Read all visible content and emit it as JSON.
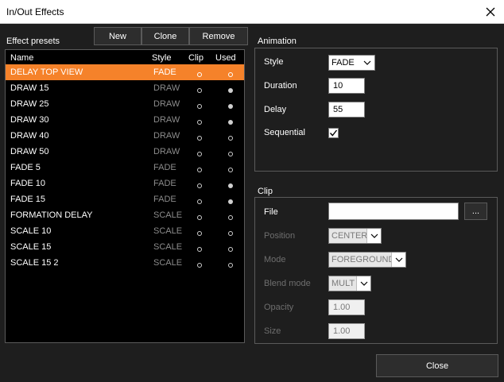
{
  "window": {
    "title": "In/Out Effects"
  },
  "presets": {
    "title": "Effect presets",
    "buttons": {
      "new": "New",
      "clone": "Clone",
      "remove": "Remove"
    },
    "columns": {
      "name": "Name",
      "style": "Style",
      "clip": "Clip",
      "used": "Used"
    },
    "rows": [
      {
        "name": "DELAY TOP VIEW",
        "style": "FADE",
        "clip": false,
        "used": false,
        "selected": true
      },
      {
        "name": "DRAW 15",
        "style": "DRAW",
        "clip": false,
        "used": true
      },
      {
        "name": "DRAW 25",
        "style": "DRAW",
        "clip": false,
        "used": true
      },
      {
        "name": "DRAW 30",
        "style": "DRAW",
        "clip": false,
        "used": true
      },
      {
        "name": "DRAW 40",
        "style": "DRAW",
        "clip": false,
        "used": false
      },
      {
        "name": "DRAW 50",
        "style": "DRAW",
        "clip": false,
        "used": false
      },
      {
        "name": "FADE 5",
        "style": "FADE",
        "clip": false,
        "used": false
      },
      {
        "name": "FADE 10",
        "style": "FADE",
        "clip": false,
        "used": true
      },
      {
        "name": "FADE 15",
        "style": "FADE",
        "clip": false,
        "used": true
      },
      {
        "name": "FORMATION DELAY",
        "style": "SCALE",
        "clip": false,
        "used": false
      },
      {
        "name": "SCALE 10",
        "style": "SCALE",
        "clip": false,
        "used": false
      },
      {
        "name": "SCALE 15",
        "style": "SCALE",
        "clip": false,
        "used": false
      },
      {
        "name": "SCALE 15 2",
        "style": "SCALE",
        "clip": false,
        "used": false
      }
    ]
  },
  "animation": {
    "title": "Animation",
    "style_label": "Style",
    "style_value": "FADE",
    "duration_label": "Duration",
    "duration_value": "10",
    "delay_label": "Delay",
    "delay_value": "55",
    "sequential_label": "Sequential",
    "sequential_checked": true
  },
  "clip": {
    "title": "Clip",
    "file_label": "File",
    "file_value": "",
    "browse_label": "...",
    "position_label": "Position",
    "position_value": "CENTER",
    "mode_label": "Mode",
    "mode_value": "FOREGROUND",
    "blend_label": "Blend mode",
    "blend_value": "MULT",
    "opacity_label": "Opacity",
    "opacity_value": "1.00",
    "size_label": "Size",
    "size_value": "1.00"
  },
  "footer": {
    "close_label": "Close"
  },
  "colors": {
    "background": "#1e1e1e",
    "selection": "#f5822a",
    "list_bg": "#000000"
  }
}
